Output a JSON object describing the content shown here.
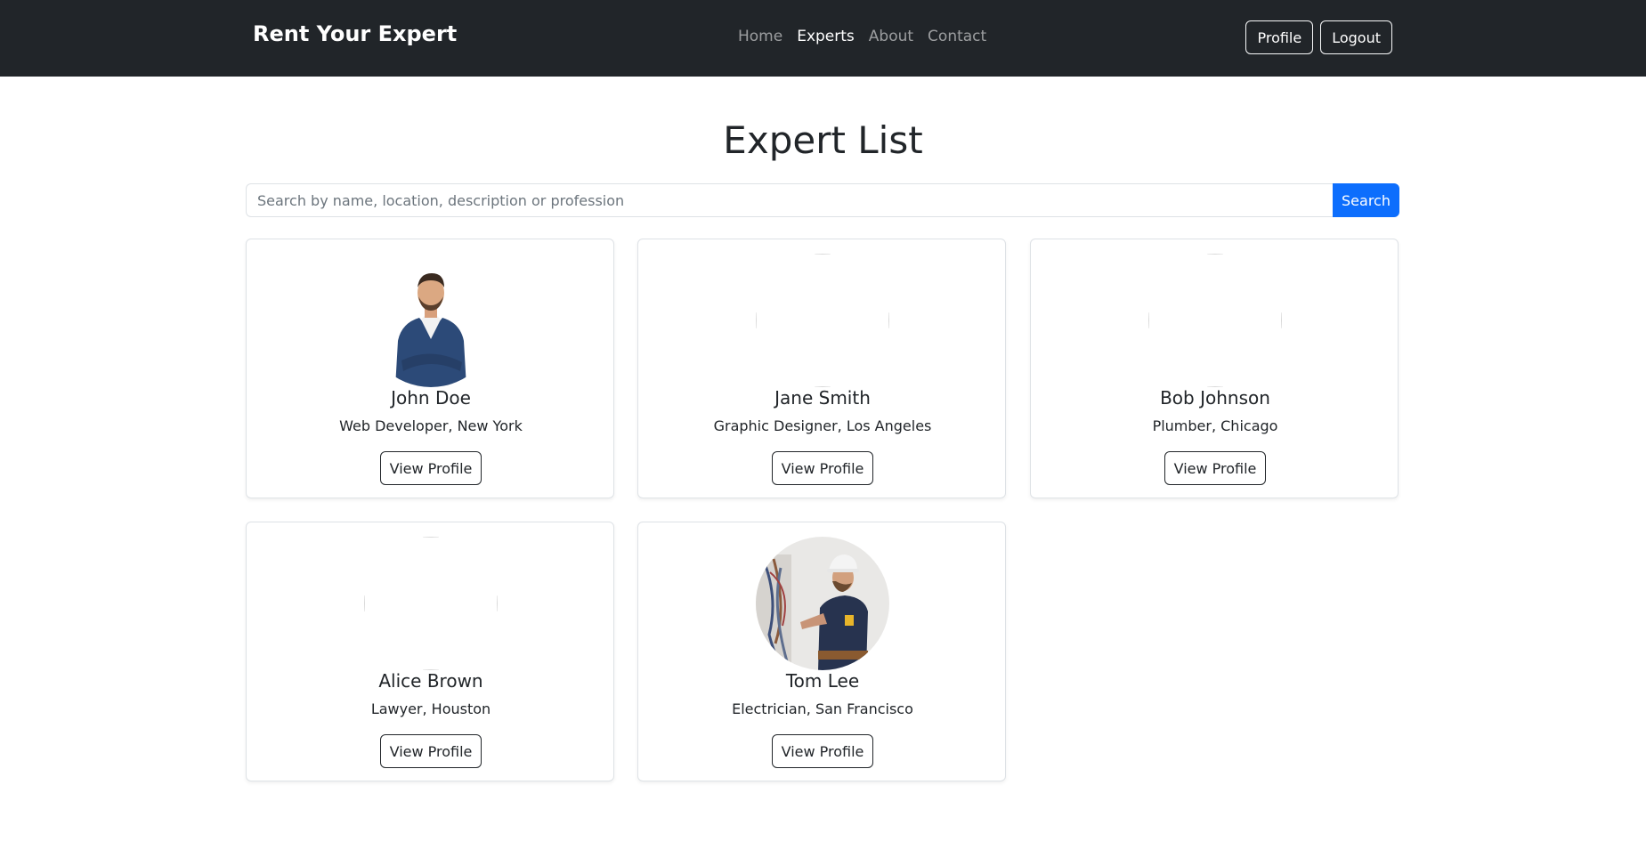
{
  "nav": {
    "brand": "Rent Your Expert",
    "links": [
      "Home",
      "Experts",
      "About",
      "Contact"
    ],
    "profile_label": "Profile",
    "logout_label": "Logout"
  },
  "main": {
    "title": "Expert List",
    "search": {
      "placeholder": "Search by name, location, description or profession",
      "value": "",
      "button_label": "Search"
    },
    "experts": [
      {
        "name": "John Doe",
        "subtitle": "Web Developer, New York",
        "button": "View Profile"
      },
      {
        "name": "Jane Smith",
        "subtitle": "Graphic Designer, Los Angeles",
        "button": "View Profile"
      },
      {
        "name": "Bob Johnson",
        "subtitle": "Plumber, Chicago",
        "button": "View Profile"
      },
      {
        "name": "Alice Brown",
        "subtitle": "Lawyer, Houston",
        "button": "View Profile"
      },
      {
        "name": "Tom Lee",
        "subtitle": "Electrician, San Francisco",
        "button": "View Profile"
      }
    ]
  },
  "colors": {
    "navbar_bg": "#212529",
    "primary": "#0d6efd",
    "text": "#212529"
  }
}
